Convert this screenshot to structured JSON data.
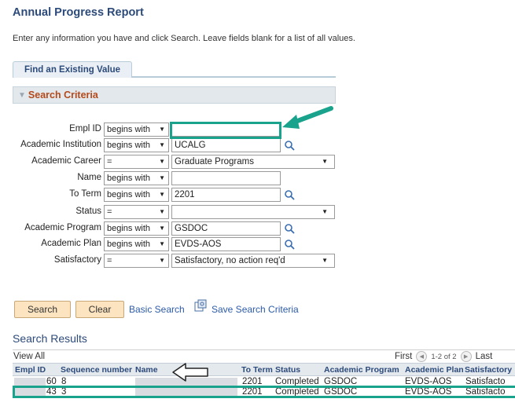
{
  "page_title": "Annual Progress Report",
  "instructions": "Enter any information you have and click Search. Leave fields blank for a list of all values.",
  "tab_label": "Find an Existing Value",
  "section_header": "Search Criteria",
  "fields": [
    {
      "label": "Empl ID",
      "operator": "begins with",
      "value": "",
      "lookup": false,
      "dropdown": false
    },
    {
      "label": "Academic Institution",
      "operator": "begins with",
      "value": "UCALG",
      "lookup": true,
      "dropdown": false
    },
    {
      "label": "Academic Career",
      "operator": "=",
      "value": "Graduate Programs",
      "lookup": false,
      "dropdown": true
    },
    {
      "label": "Name",
      "operator": "begins with",
      "value": "",
      "lookup": false,
      "dropdown": false
    },
    {
      "label": "To Term",
      "operator": "begins with",
      "value": "2201",
      "lookup": true,
      "dropdown": false
    },
    {
      "label": "Status",
      "operator": "=",
      "value": "",
      "lookup": false,
      "dropdown": true
    },
    {
      "label": "Academic Program",
      "operator": "begins with",
      "value": "GSDOC",
      "lookup": true,
      "dropdown": false
    },
    {
      "label": "Academic Plan",
      "operator": "begins with",
      "value": "EVDS-AOS",
      "lookup": true,
      "dropdown": false
    },
    {
      "label": "Satisfactory",
      "operator": "=",
      "value": "Satisfactory, no action req'd",
      "lookup": false,
      "dropdown": true
    }
  ],
  "buttons": {
    "search": "Search",
    "clear": "Clear"
  },
  "links": {
    "basic_search": "Basic Search",
    "save_criteria": "Save Search Criteria"
  },
  "results": {
    "title": "Search Results",
    "view_all": "View All",
    "first": "First",
    "count": "1-2 of 2",
    "last": "Last",
    "columns": [
      "Empl ID",
      "Sequence number",
      "Name",
      "To Term",
      "Status",
      "Academic Program",
      "Academic Plan",
      "Satisfactory"
    ],
    "rows": [
      {
        "empl_id": "60",
        "seq": "8",
        "to_term": "2201",
        "status": "Completed",
        "program": "GSDOC",
        "plan": "EVDS-AOS",
        "satisfactory": "Satisfacto"
      },
      {
        "empl_id": "43",
        "seq": "3",
        "to_term": "2201",
        "status": "Completed",
        "program": "GSDOC",
        "plan": "EVDS-AOS",
        "satisfactory": "Satisfacto"
      }
    ]
  },
  "colors": {
    "accent_teal": "#1aa38c",
    "title_blue": "#2c4a7a",
    "section_orange": "#b44a1b",
    "button_bg": "#fbe4bf"
  }
}
